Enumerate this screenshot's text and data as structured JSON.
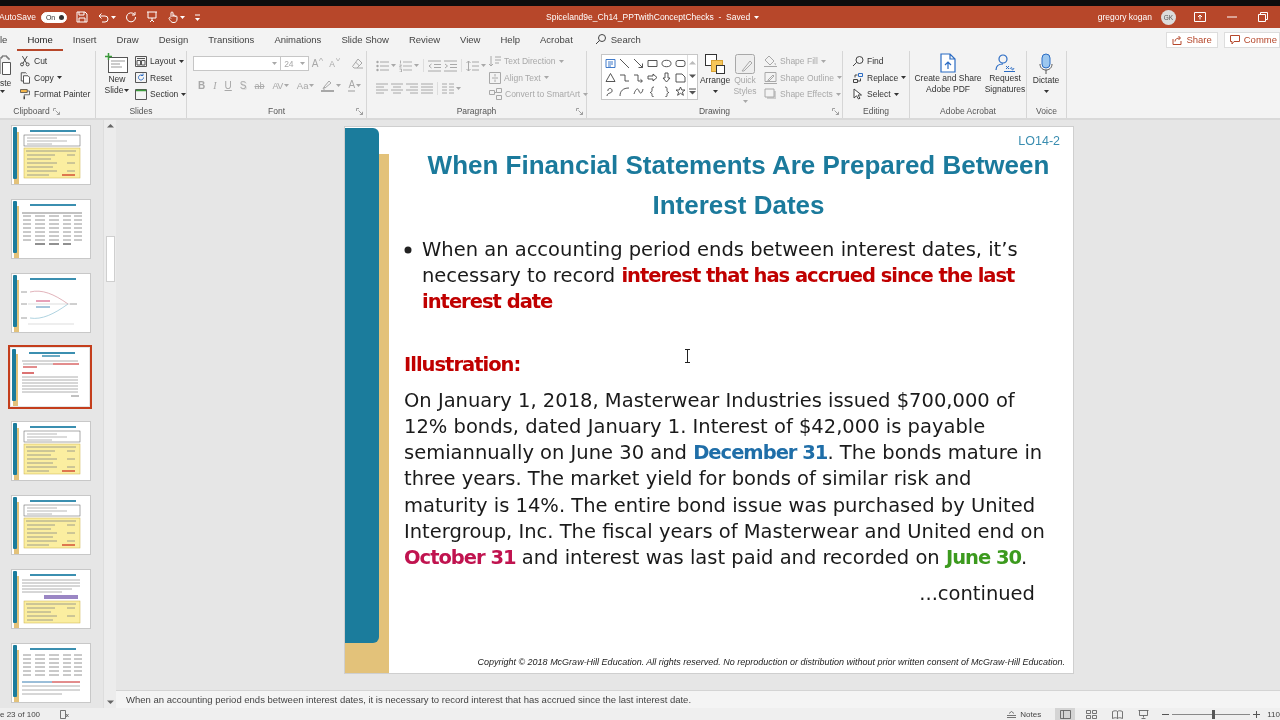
{
  "title_bar": {
    "autosave_label": "AutoSave",
    "autosave": {
      "label": "On",
      "on": true
    },
    "document_title": "Spiceland9e_Ch14_PPTwithConceptChecks  -  Saved",
    "user_name": "gregory kogan",
    "avatar_initials": "GK"
  },
  "tabs": [
    {
      "label": "le",
      "selected": false
    },
    {
      "label": "Home",
      "selected": true
    },
    {
      "label": "Insert",
      "selected": false
    },
    {
      "label": "Draw",
      "selected": false
    },
    {
      "label": "Design",
      "selected": false
    },
    {
      "label": "Transitions",
      "selected": false
    },
    {
      "label": "Animations",
      "selected": false
    },
    {
      "label": "Slide Show",
      "selected": false
    },
    {
      "label": "Review",
      "selected": false
    },
    {
      "label": "View",
      "selected": false
    },
    {
      "label": "Help",
      "selected": false
    },
    {
      "label": "Acrobat",
      "selected": false
    }
  ],
  "search": {
    "label": "Search"
  },
  "share_button": "Share",
  "comments_button": "Comme",
  "ribbon": {
    "clipboard": {
      "title": "Clipboard",
      "paste": "ste",
      "cut": "Cut",
      "copy": "Copy",
      "format_painter": "Format Painter"
    },
    "slides": {
      "title": "Slides",
      "new_slide": "New Slide",
      "layout": "Layout",
      "reset": "Reset",
      "section": "Section"
    },
    "font": {
      "title": "Font",
      "disabled": true,
      "size": "24",
      "grow": "A",
      "shrink": "A",
      "styles": [
        {
          "glyph": "B",
          "kind": "bold"
        },
        {
          "glyph": "I",
          "kind": "italic"
        },
        {
          "glyph": "U",
          "kind": "underline"
        },
        {
          "glyph": "S",
          "kind": "shadow"
        },
        {
          "glyph": "ab",
          "kind": "strikethrough"
        },
        {
          "glyph": "AV",
          "kind": "spacing"
        },
        {
          "glyph": "Aa",
          "kind": "case"
        }
      ],
      "font_color": "A"
    },
    "paragraph": {
      "title": "Paragraph",
      "disabled": true,
      "text_direction": "Text Direction",
      "align_text": "Align Text",
      "convert_to_smartart": "Convert to SmartArt"
    },
    "drawing": {
      "title": "Drawing",
      "arrange": {
        "label": "Arrange",
        "disabled": false
      },
      "quick_styles": {
        "label": "Quick Styles",
        "disabled": true
      },
      "shape_fill": {
        "label": "Shape Fill",
        "disabled": true
      },
      "shape_outline": {
        "label": "Shape Outline",
        "disabled": true
      },
      "shape_effects": {
        "label": "Shape Effects",
        "disabled": true
      }
    },
    "editing": {
      "title": "Editing",
      "find": "Find",
      "replace": "Replace",
      "select": "Select"
    },
    "adobe_acrobat": {
      "title": "Adobe Acrobat",
      "create_pdf": "Create and Share Adobe PDF",
      "request_signatures": "Request Signatures"
    },
    "voice": {
      "title": "Voice",
      "dictate": "Dictate"
    }
  },
  "thumbnails": [
    {
      "kind": "journal",
      "selected": false
    },
    {
      "kind": "schedule",
      "selected": false
    },
    {
      "kind": "chart",
      "selected": false
    },
    {
      "kind": "text",
      "selected": true
    },
    {
      "kind": "journal",
      "selected": false
    },
    {
      "kind": "journal",
      "selected": false
    },
    {
      "kind": "text_journal",
      "selected": false
    },
    {
      "kind": "schedule_text",
      "selected": false
    }
  ],
  "slide": {
    "objective": "LO14-2",
    "title": "When Financial Statements Are Prepared Between Interest Dates",
    "bullets": [
      {
        "runs": [
          {
            "text": "When an accounting period ends between interest dates, it’s necessary to record "
          },
          {
            "text": "interest that has accrued since the last interest date",
            "color": "#c00000"
          }
        ]
      }
    ],
    "heading": "Illustration:",
    "paragraph": {
      "runs": [
        {
          "text": "On January 1, 2018, Masterwear Industries issued $700,000 of 12% bonds, dated January 1. Interest of $42,000 is payable semiannually on June 30 and "
        },
        {
          "text": "December 31",
          "color": "#1f6ea8"
        },
        {
          "text": ". The bonds mature in three years. The market yield for bonds of similar risk and maturity is 14%. The entire bond issue was purchased by United Intergroup, Inc. The fiscal years of Masterwear and United end on "
        },
        {
          "text": "October 31",
          "color": "#c0134f"
        },
        {
          "text": " and interest was last paid and recorded on "
        },
        {
          "text": "June 30",
          "color": "#3c9a1e"
        },
        {
          "text": "."
        }
      ]
    },
    "continued": "...continued",
    "copyright": "Copyright © 2018 McGraw-Hill Education. All rights reserved. No reproduction or distribution without prior written consent of McGraw-Hill Education."
  },
  "notes": "When an accounting period ends between interest dates, it is necessary to record interest that has accrued since the last interest date.",
  "status_bar": {
    "slide_counter": "e 23 of 100",
    "notes_button": "Notes",
    "views": [
      {
        "kind": "normal",
        "selected": true
      },
      {
        "kind": "sorter",
        "selected": false
      },
      {
        "kind": "reading",
        "selected": false
      },
      {
        "kind": "slideshow",
        "selected": false
      }
    ],
    "zoom_slider": {
      "level": 0.52
    },
    "zoom": "110"
  }
}
